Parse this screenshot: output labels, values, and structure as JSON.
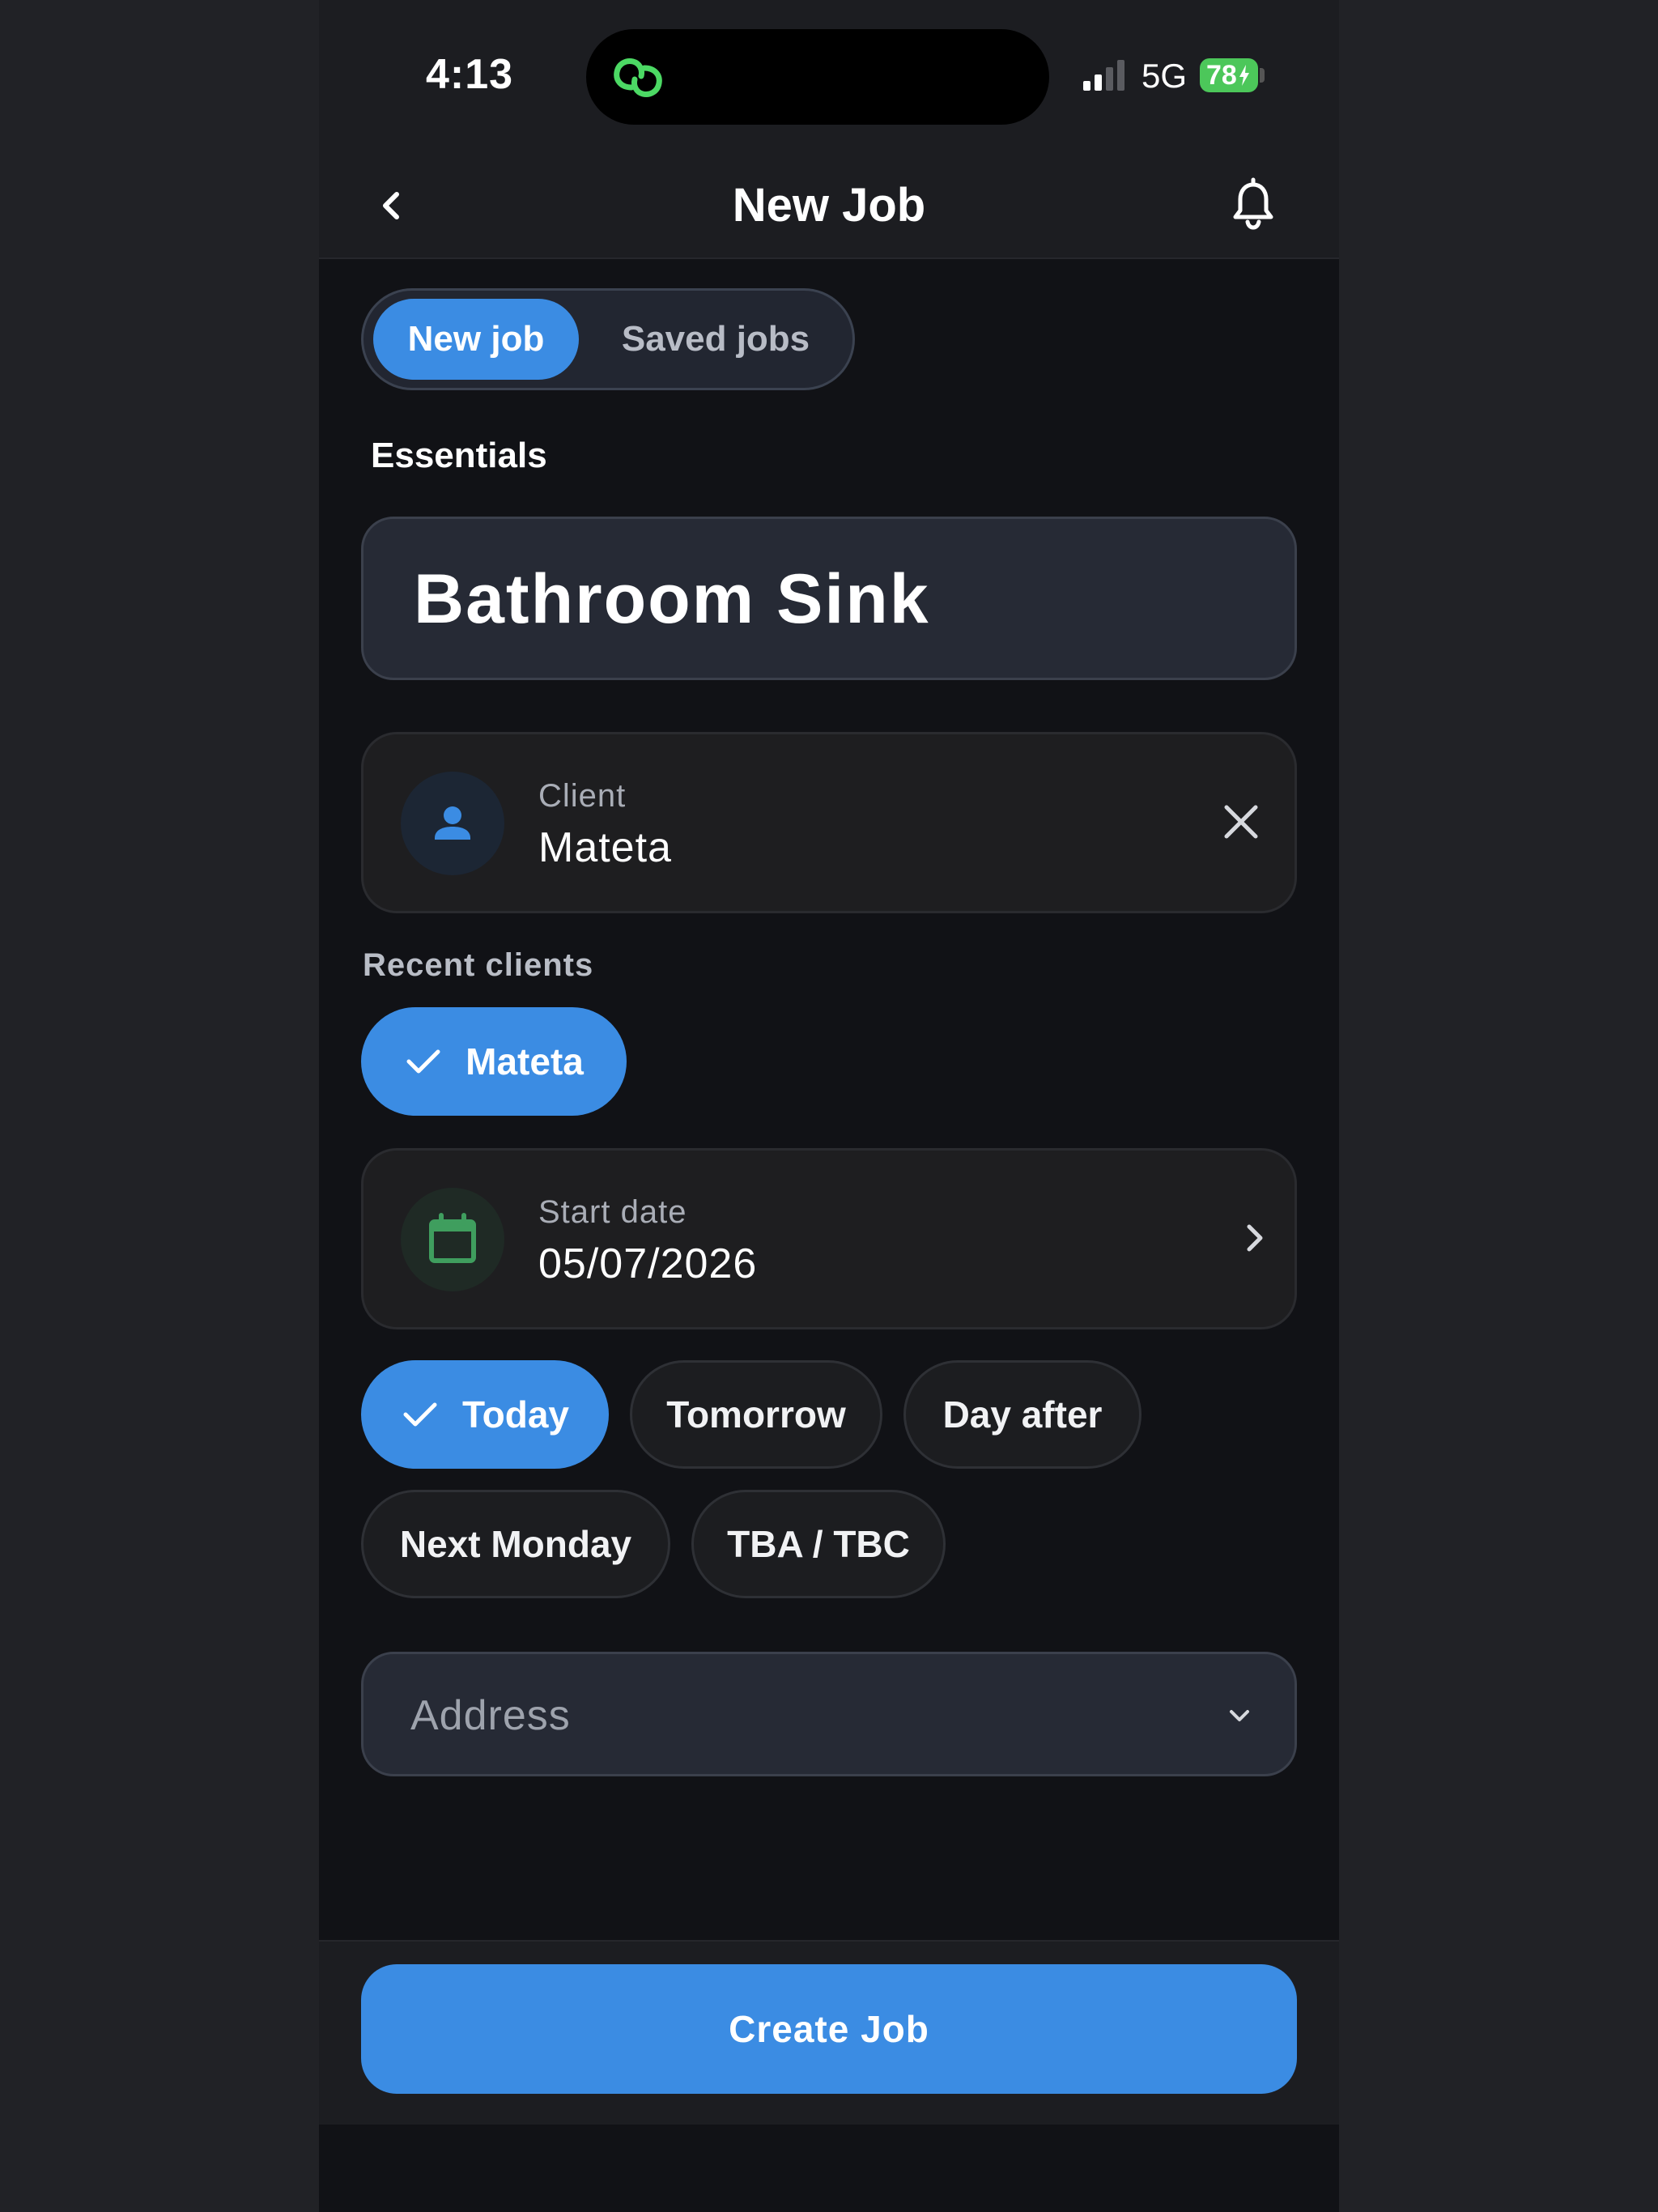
{
  "status_bar": {
    "time": "4:13",
    "network": "5G",
    "battery": "78",
    "island_icon": "link-icon"
  },
  "header": {
    "title": "New Job",
    "back_icon": "chevron-left-icon",
    "notification_icon": "bell-icon"
  },
  "tabs": [
    {
      "label": "New job",
      "active": true
    },
    {
      "label": "Saved jobs",
      "active": false
    }
  ],
  "essentials": {
    "section_label": "Essentials",
    "job_title_value": "Bathroom Sink"
  },
  "client": {
    "label": "Client",
    "value": "Mateta",
    "icon": "person-icon",
    "clear_icon": "close-icon"
  },
  "recent_clients": {
    "label": "Recent clients",
    "items": [
      {
        "label": "Mateta",
        "selected": true
      }
    ]
  },
  "start_date": {
    "label": "Start date",
    "value": "05/07/2026",
    "icon": "calendar-icon",
    "chevron_icon": "chevron-right-icon"
  },
  "date_presets": [
    {
      "label": "Today",
      "selected": true
    },
    {
      "label": "Tomorrow",
      "selected": false
    },
    {
      "label": "Day after",
      "selected": false
    },
    {
      "label": "Next Monday",
      "selected": false
    },
    {
      "label": "TBA / TBC",
      "selected": false
    }
  ],
  "address": {
    "placeholder": "Address",
    "chevron_icon": "chevron-down-icon"
  },
  "create_button": "Create Job",
  "colors": {
    "accent": "#3b8ce3",
    "background": "#111216",
    "card": "#1e1e20",
    "calendar_green": "#3f9e5e",
    "battery_green": "#4cc75a"
  }
}
